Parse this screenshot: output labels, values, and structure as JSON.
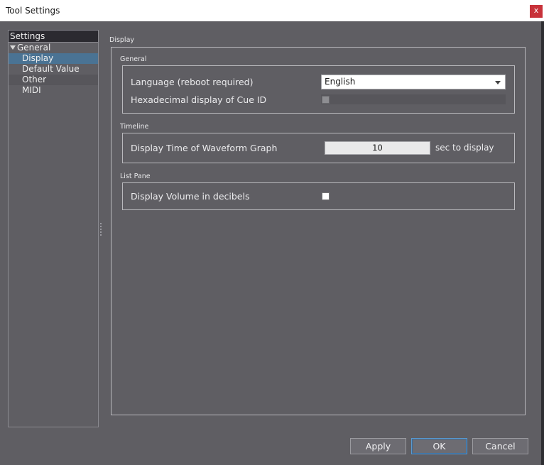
{
  "window": {
    "title": "Tool Settings",
    "close_label": "x"
  },
  "sidebar": {
    "header": "Settings",
    "group": "General",
    "items": [
      {
        "label": "Display",
        "selected": true
      },
      {
        "label": "Default Value",
        "selected": false
      },
      {
        "label": "Other",
        "selected": false
      },
      {
        "label": "MIDI",
        "selected": false
      }
    ]
  },
  "main": {
    "section_title": "Display",
    "general": {
      "label": "General",
      "language_label": "Language (reboot required)",
      "language_value": "English",
      "hex_label": "Hexadecimal display of Cue ID",
      "hex_checked": false
    },
    "timeline": {
      "label": "Timeline",
      "waveform_label": "Display Time of Waveform Graph",
      "waveform_value": "10",
      "waveform_unit": "sec to display"
    },
    "list_pane": {
      "label": "List Pane",
      "volume_label": "Display Volume in decibels",
      "volume_checked": false
    }
  },
  "buttons": {
    "apply": "Apply",
    "ok": "OK",
    "cancel": "Cancel"
  },
  "colors": {
    "background": "#5f5e63",
    "selection": "#4a7394",
    "close": "#c8323a"
  }
}
